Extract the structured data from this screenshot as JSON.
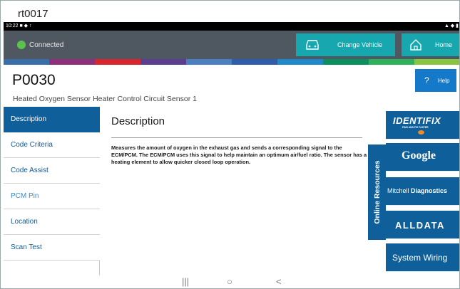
{
  "window": {
    "title": "rt0017"
  },
  "statusbar": {
    "time": "10:22",
    "icons": "■ ◆ ↑",
    "right_icons": "▲ ◆ ▮"
  },
  "header": {
    "connection_status": "Connected",
    "change_vehicle_label": "Change Vehicle",
    "home_label": "Home"
  },
  "colors": {
    "accent": "#17a7ae",
    "primary": "#0e5f9a",
    "connected": "#5cc24f",
    "stripe": [
      "#3a6ea8",
      "#8e2f7a",
      "#d8262e",
      "#5b3e90",
      "#4a7fc0",
      "#2f5da9",
      "#1e88c8",
      "#0b8f5e",
      "#2fb15a",
      "#88c540"
    ]
  },
  "code": {
    "id": "P0030",
    "description": "Heated Oxygen Sensor Heater Control Circuit Sensor 1",
    "help_label": "Help"
  },
  "tabs": [
    {
      "label": "Description"
    },
    {
      "label": "Code Criteria"
    },
    {
      "label": "Code Assist"
    },
    {
      "label": "PCM Pin"
    },
    {
      "label": "Location"
    },
    {
      "label": "Scan Test"
    }
  ],
  "content": {
    "title": "Description",
    "body": "Measures the amount of oxygen in the exhaust gas and sends a corresponding signal to the ECM/PCM. The ECM/PCM uses this signal to help maintain an optimum air/fuel ratio. The sensor has a heating element to allow quicker closed loop operation."
  },
  "resources": {
    "tab_label": "Online Resources",
    "identifix": {
      "name": "IDENTIFIX",
      "tagline": "FIND AND FIX FASTER"
    },
    "google": {
      "name": "Google"
    },
    "mitchell": {
      "name_plain": "Mitchell ",
      "name_bold": "Diagnostics"
    },
    "alldata": {
      "name": "ALLDATA"
    },
    "wiring": {
      "name": "System Wiring"
    }
  },
  "navbar": {
    "recents": "|||",
    "home": "○",
    "back": "<"
  }
}
